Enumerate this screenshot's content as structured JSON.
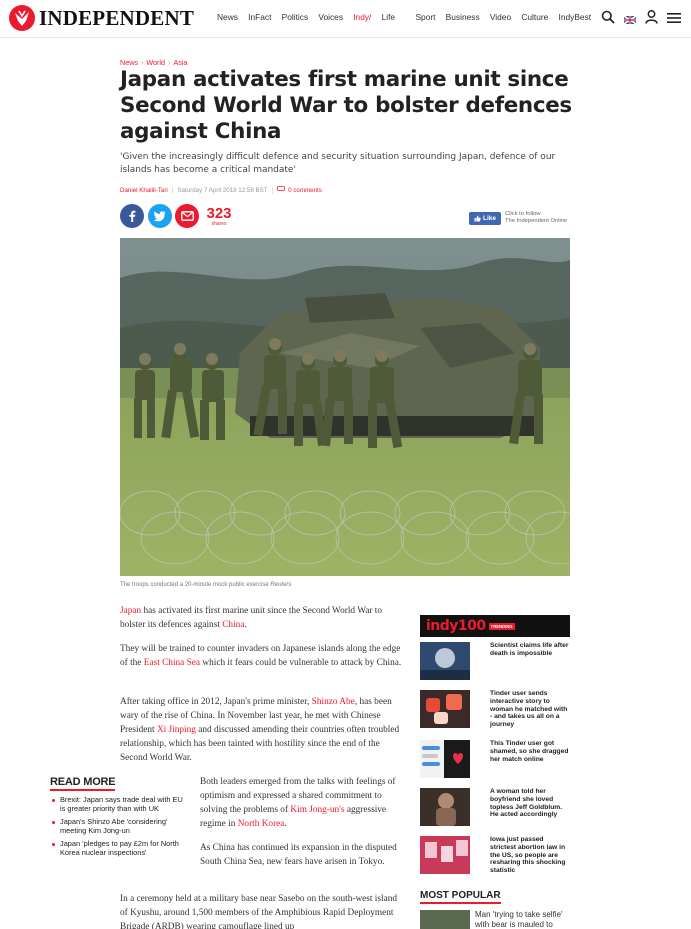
{
  "header": {
    "logo_text": "INDEPENDENT",
    "nav": [
      "News",
      "InFact",
      "Politics",
      "Voices",
      "Sport",
      "Business",
      "Video",
      "Culture",
      "IndyBest"
    ],
    "indy_life": {
      "prefix": "Indy/",
      "suffix": "Life"
    },
    "tools": [
      "search-icon",
      "uk-flag-icon",
      "user-icon",
      "menu-icon"
    ]
  },
  "article": {
    "breadcrumbs": [
      "News",
      "World",
      "Asia"
    ],
    "headline": "Japan activates first marine unit since Second World War to bolster defences against China",
    "standfirst": "'Given the increasingly difficult defence and security situation surrounding Japan, defence of our islands has become a critical mandate'",
    "author": "Daniel Khalili-Tari",
    "date": "Saturday 7 April 2018 12:58 BST",
    "comments": "0 comments",
    "share_count": "323",
    "share_label": "shares",
    "fb_like": {
      "button": "Like",
      "line1": "Click to follow",
      "line2": "The Independent Online"
    },
    "caption": "The troops conducted a 20-minute mock public exercise",
    "caption_credit": "Reuters",
    "paragraphs": {
      "p1_link": "Japan",
      "p1_text": " has activated its first marine unit since the Second World War to bolster its defences against ",
      "p1_link2": "China",
      "p1_end": ".",
      "p2_text": "They will be trained to counter invaders on Japanese islands along the edge of the ",
      "p2_link": "East China Sea",
      "p2_end": " which it fears could be vulnerable to attack by China.",
      "p3_text": "After taking office in 2012, Japan's prime minister, ",
      "p3_link": "Shinzo Abe",
      "p3_mid": ", has been wary of the rise of China. In November last year, he met with Chinese President ",
      "p3_link2": "Xi Jinping",
      "p3_end": " and discussed amending their countries often troubled relationship, which has been tainted with hostility since the end of the Second World War.",
      "p4_text": "Both leaders emerged from the talks with feelings of optimism and expressed a shared commitment to solving the problems of ",
      "p4_link": "Kim Jong-un's",
      "p4_mid": " aggressive regime in ",
      "p4_link2": "North Korea",
      "p4_end": ".",
      "p5_text": "As China has continued its expansion in the disputed South China Sea, new fears have arisen in Tokyo.",
      "p6_text": "In a ceremony held at a military base near Sasebo on the south-west island of Kyushu, around 1,500 members of the Amphibious Rapid Deployment Brigade (ARDB) wearing camouflage lined up"
    }
  },
  "read_more": {
    "title": "READ MORE",
    "items": [
      "Brexit: Japan says trade deal with EU is greater priority than with UK",
      "Japan's Shinzo Abe 'considering' meeting Kim Jong-un",
      "Japan 'pledges to pay £2m for North Korea nuclear inspections'"
    ]
  },
  "sidebar": {
    "indy100": {
      "brand": "indy100",
      "badge": "TRENDING"
    },
    "items": [
      "Scientist claims life after death is impossible",
      "Tinder user sends interactive story to woman he matched with - and takes us all on a journey",
      "This Tinder user got shamed, so she dragged her match online",
      "A woman told her boyfriend she loved topless Jeff Goldblum. He acted accordingly",
      "Iowa just passed strictest abortion law in the US, so people are resharing this shocking statistic"
    ],
    "most_popular": {
      "title": "MOST POPULAR",
      "items": [
        "Man 'trying to take selfie' with bear is mauled to death"
      ]
    }
  },
  "colors": {
    "brand_red": "#ec1a2e",
    "facebook": "#3b5998",
    "twitter": "#1da1f2"
  }
}
